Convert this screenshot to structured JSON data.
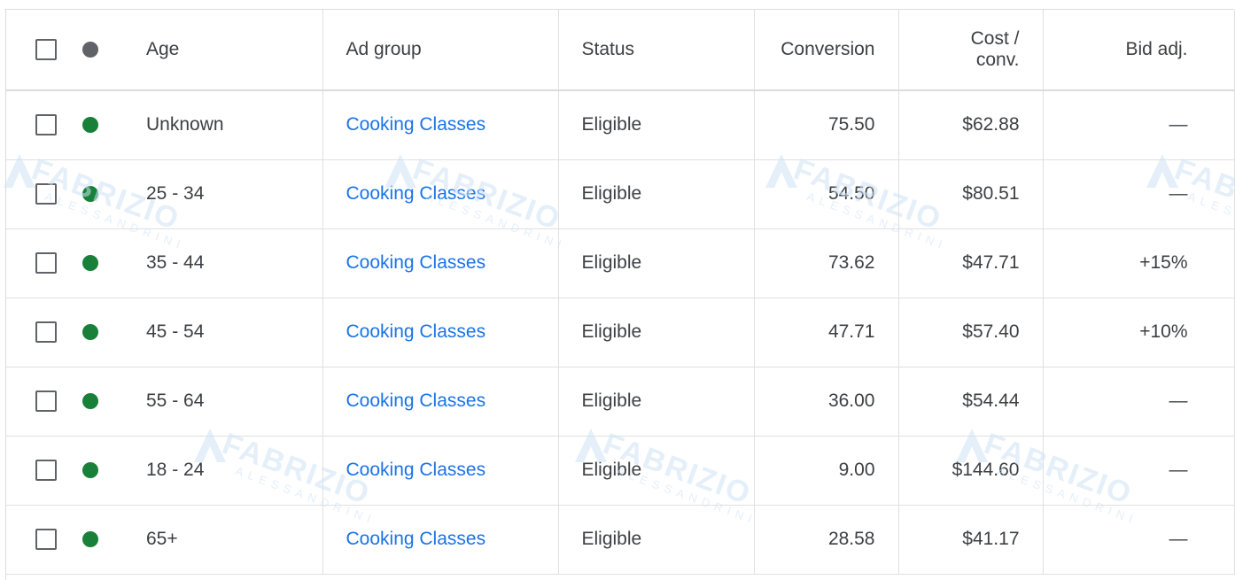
{
  "table": {
    "headers": {
      "age": "Age",
      "ad_group": "Ad group",
      "status": "Status",
      "conversions": "Conversion",
      "cost_per_conv_line1": "Cost /",
      "cost_per_conv_line2": "conv.",
      "bid_adj": "Bid adj."
    },
    "rows": [
      {
        "age": "Unknown",
        "ad_group": "Cooking Classes",
        "status": "Eligible",
        "conversions": "75.50",
        "cost_per_conv": "$62.88",
        "bid_adj": "—"
      },
      {
        "age": "25 - 34",
        "ad_group": "Cooking Classes",
        "status": "Eligible",
        "conversions": "54.50",
        "cost_per_conv": "$80.51",
        "bid_adj": "—"
      },
      {
        "age": "35 - 44",
        "ad_group": "Cooking Classes",
        "status": "Eligible",
        "conversions": "73.62",
        "cost_per_conv": "$47.71",
        "bid_adj": "+15%"
      },
      {
        "age": "45 - 54",
        "ad_group": "Cooking Classes",
        "status": "Eligible",
        "conversions": "47.71",
        "cost_per_conv": "$57.40",
        "bid_adj": "+10%"
      },
      {
        "age": "55 - 64",
        "ad_group": "Cooking Classes",
        "status": "Eligible",
        "conversions": "36.00",
        "cost_per_conv": "$54.44",
        "bid_adj": "—"
      },
      {
        "age": "18 - 24",
        "ad_group": "Cooking Classes",
        "status": "Eligible",
        "conversions": "9.00",
        "cost_per_conv": "$144.60",
        "bid_adj": "—"
      },
      {
        "age": "65+",
        "ad_group": "Cooking Classes",
        "status": "Eligible",
        "conversions": "28.58",
        "cost_per_conv": "$41.17",
        "bid_adj": "—"
      }
    ]
  },
  "watermark": {
    "name": "FABRIZIO",
    "surname": "ALESSANDRINI"
  },
  "colors": {
    "link": "#1a73e8",
    "status_enabled": "#188038",
    "status_header": "#5f6368"
  }
}
